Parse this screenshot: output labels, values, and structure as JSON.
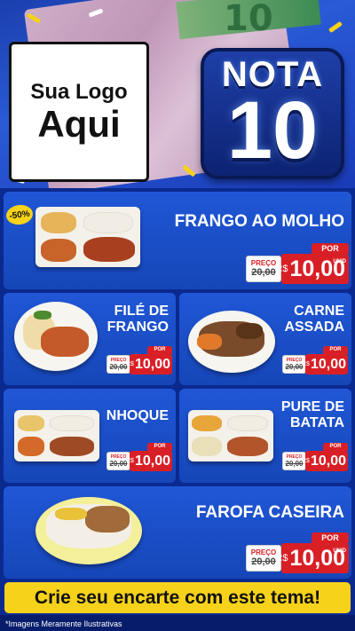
{
  "header": {
    "logo_line1": "Sua Logo",
    "logo_line2": "Aqui",
    "badge_word": "NOTA",
    "badge_number": "10",
    "money_digits": "10"
  },
  "discount_badge": "-50%",
  "price_common": {
    "por": "POR",
    "preco": "PREÇO",
    "rs": "R$",
    "unid": "UNID",
    "old_prefix": "R$",
    "old_value": "20,00",
    "new_value": "10,00"
  },
  "products": [
    {
      "name_line1": "FRANGO AO MOLHO",
      "name_line2": ""
    },
    {
      "name_line1": "FILÉ DE",
      "name_line2": "FRANGO"
    },
    {
      "name_line1": "CARNE",
      "name_line2": "ASSADA"
    },
    {
      "name_line1": "NHOQUE",
      "name_line2": ""
    },
    {
      "name_line1": "PURE DE",
      "name_line2": "BATATA"
    },
    {
      "name_line1": "FAROFA CASEIRA",
      "name_line2": ""
    }
  ],
  "cta": "Crie seu encarte com este tema!",
  "disclaimer": "*Imagens Meramente Ilustrativas",
  "colors": {
    "background": "#1646b8",
    "accent_red": "#d91f26",
    "accent_yellow": "#f6d21a"
  }
}
